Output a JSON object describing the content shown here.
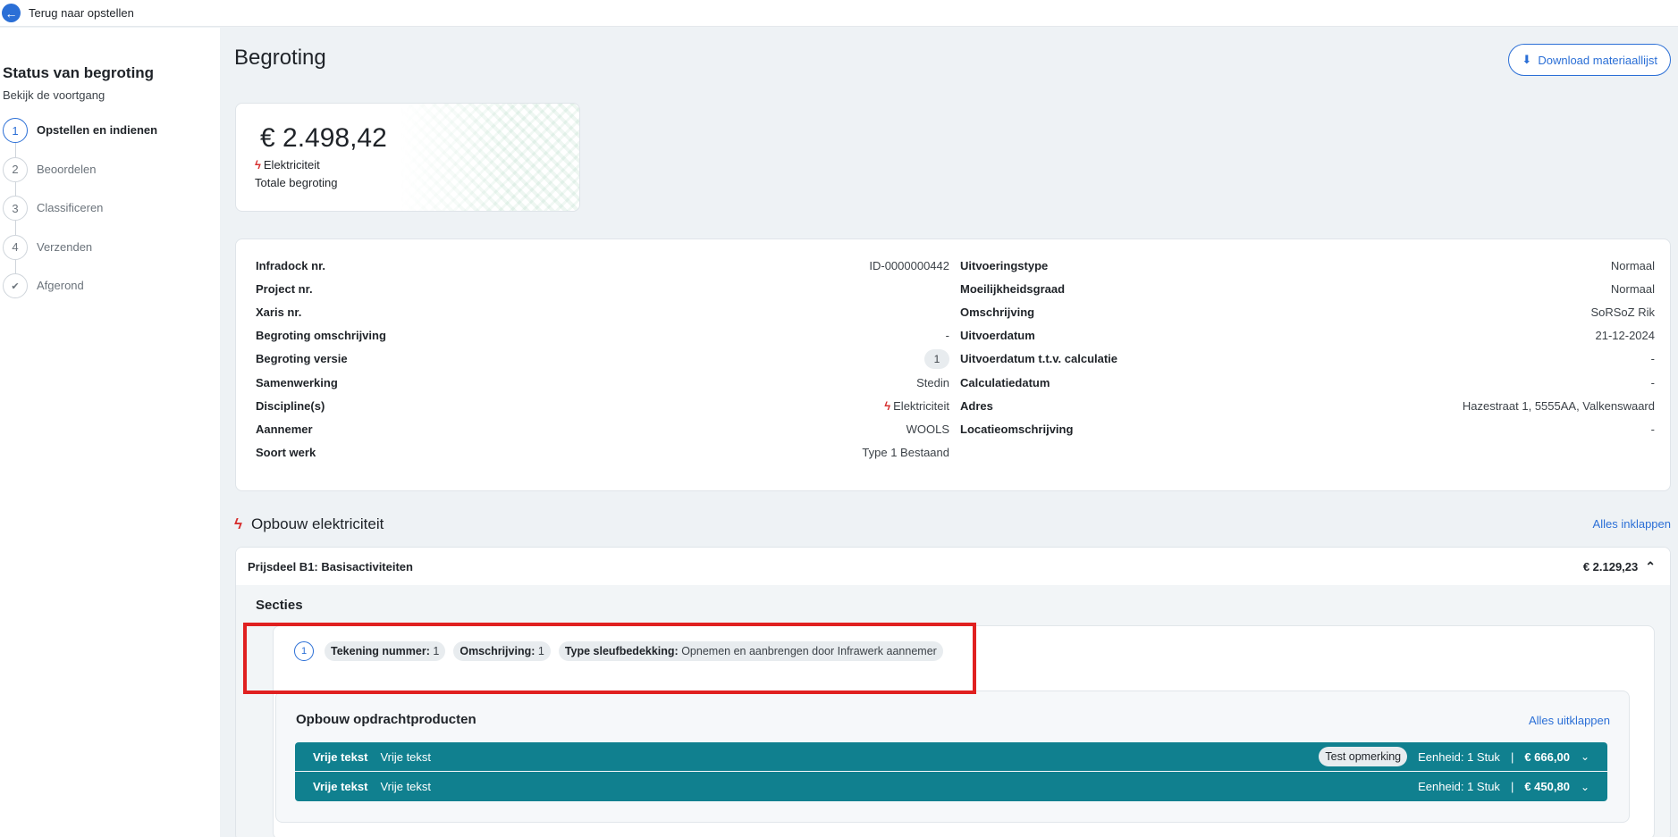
{
  "topbar": {
    "back_label": "Terug naar opstellen",
    "back_icon": "arrow-left-icon"
  },
  "sidebar": {
    "title": "Status van begroting",
    "subtitle": "Bekijk de voortgang",
    "steps": [
      {
        "num": "1",
        "label": "Opstellen en indienen",
        "active": true
      },
      {
        "num": "2",
        "label": "Beoordelen"
      },
      {
        "num": "3",
        "label": "Classificeren"
      },
      {
        "num": "4",
        "label": "Verzenden"
      },
      {
        "num": "✔",
        "label": "Afgerond"
      }
    ]
  },
  "header": {
    "title": "Begroting",
    "download_label": "Download materiaallijst"
  },
  "total": {
    "amount": "€ 2.498,42",
    "discipline": "Elektriciteit",
    "label": "Totale begroting"
  },
  "info": {
    "left": [
      {
        "key": "Infradock nr.",
        "value": "ID-0000000442"
      },
      {
        "key": "Project nr.",
        "value": ""
      },
      {
        "key": "Xaris nr.",
        "value": ""
      },
      {
        "key": "Begroting omschrijving",
        "value": "-"
      },
      {
        "key": "Begroting versie",
        "value": "1"
      },
      {
        "key": "Samenwerking",
        "value": "Stedin"
      },
      {
        "key": "Discipline(s)",
        "value": "Elektriciteit"
      },
      {
        "key": "Aannemer",
        "value": "WOOLS"
      },
      {
        "key": "Soort werk",
        "value": "Type 1 Bestaand"
      }
    ],
    "right": [
      {
        "key": "Uitvoeringstype",
        "value": "Normaal"
      },
      {
        "key": "Moeilijkheidsgraad",
        "value": "Normaal"
      },
      {
        "key": "Omschrijving",
        "value": "SoRSoZ Rik"
      },
      {
        "key": "Uitvoerdatum",
        "value": "21-12-2024"
      },
      {
        "key": "Uitvoerdatum t.t.v. calculatie",
        "value": "-"
      },
      {
        "key": "Calculatiedatum",
        "value": "-"
      },
      {
        "key": "Adres",
        "value": "Hazestraat 1, 5555AA, Valkenswaard"
      },
      {
        "key": "Locatieomschrijving",
        "value": "-"
      }
    ]
  },
  "opbouw": {
    "title": "Opbouw elektriciteit",
    "collapse_all": "Alles inklappen",
    "prijsdeel": {
      "title": "Prijsdeel B1: Basisactiviteiten",
      "amount": "€ 2.129,23",
      "secties_title": "Secties",
      "sectie": {
        "num": "1",
        "chips": [
          {
            "key": "Tekening nummer:",
            "value": "1"
          },
          {
            "key": "Omschrijving:",
            "value": "1"
          },
          {
            "key": "Type sleufbedekking:",
            "value": "Opnemen en aanbrengen door Infrawerk aannemer"
          }
        ]
      },
      "producten": {
        "title": "Opbouw opdrachtproducten",
        "expand_all": "Alles uitklappen",
        "rows": [
          {
            "type": "Vrije tekst",
            "name": "Vrije tekst",
            "remark": "Test opmerking",
            "unit": "Eenheid: 1 Stuk",
            "sep": "|",
            "price": "€ 666,00"
          },
          {
            "type": "Vrije tekst",
            "name": "Vrije tekst",
            "unit": "Eenheid: 1 Stuk",
            "sep": "|",
            "price": "€ 450,80"
          }
        ]
      }
    }
  },
  "colors": {
    "accent": "#2b6fd6",
    "teal": "#10808f",
    "bolt": "#d62f2f",
    "highlight": "#e02020"
  }
}
